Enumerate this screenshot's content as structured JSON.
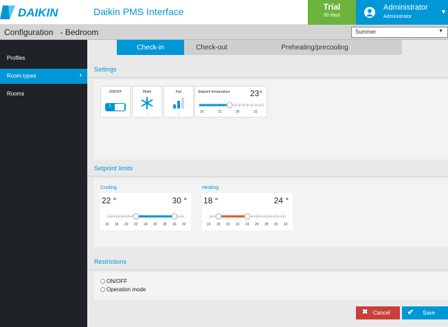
{
  "header": {
    "logo_text": "DAIKIN",
    "app_title": "Daikin PMS Interface",
    "trial_title": "Trial",
    "trial_days": "30 days",
    "user_name": "Administrator",
    "user_role": "Administrator"
  },
  "subheader": {
    "breadcrumb": "Configuration   - Bedroom",
    "season": "Summer"
  },
  "sidebar": {
    "items": [
      {
        "label": "Profiles"
      },
      {
        "label": "Room types"
      },
      {
        "label": "Rooms"
      }
    ]
  },
  "tabs": [
    {
      "label": "Check-in"
    },
    {
      "label": "Check-out"
    },
    {
      "label": "Preheating/precooling"
    }
  ],
  "settings": {
    "title": "Settings",
    "onoff_label": "ON/OFF",
    "onoff_state": "I",
    "mode_label": "Mode",
    "fan_label": "Fan",
    "setpoint_label": "Setpoint temperature",
    "setpoint_value": "23°",
    "setpoint_ticks": [
      "16",
      "21",
      "26",
      "31"
    ],
    "setpoint_level": 0.47
  },
  "setpoint_limits": {
    "title": "Setpoint limits",
    "cooling": {
      "label": "Cooling",
      "min": "22 °",
      "max": "30 °",
      "ticks": [
        "16",
        "18",
        "20",
        "22",
        "24",
        "26",
        "28",
        "30",
        "32"
      ]
    },
    "heating": {
      "label": "Heating",
      "min": "18 °",
      "max": "24 °",
      "ticks": [
        "16",
        "18",
        "20",
        "22",
        "24",
        "26",
        "28",
        "30",
        "32"
      ]
    }
  },
  "restrictions": {
    "title": "Restrictions",
    "options": [
      {
        "label": "ON/OFF"
      },
      {
        "label": "Operation mode"
      }
    ]
  },
  "actions": {
    "cancel": "Cancel",
    "save": "Save"
  },
  "colors": {
    "accent": "#0097d7",
    "trial": "#6cb33e",
    "cancel": "#c9403a",
    "heating": "#e05a1c"
  }
}
